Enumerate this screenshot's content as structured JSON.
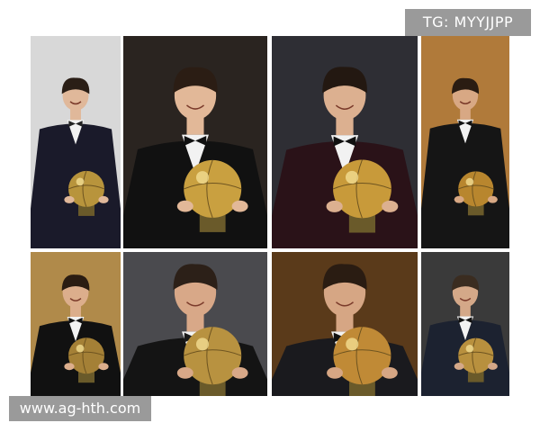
{
  "watermarks": {
    "top_right": "TG: MYYJJPP",
    "bottom_left": "www.ag-hth.com"
  },
  "tiles": [
    {
      "bg": "#d8d8d8",
      "suit": "#1a1a2a",
      "skin": "#e0b89a",
      "hair": "#2a1e16",
      "trophy": "#b8943c",
      "tie": "#222222"
    },
    {
      "bg": "#2a2420",
      "suit": "#111111",
      "skin": "#e2b898",
      "hair": "#2b1d14",
      "trophy": "#c9a040",
      "tie": "#111111"
    },
    {
      "bg": "#2e2e34",
      "suit": "#2a1218",
      "skin": "#dcb090",
      "hair": "#231811",
      "trophy": "#c89a3a",
      "tie": "#111111"
    },
    {
      "bg": "#b07a3a",
      "suit": "#151515",
      "skin": "#d8a884",
      "hair": "#2a1c12",
      "trophy": "#b8862e",
      "tie": "#111111"
    },
    {
      "bg": "#b08a4a",
      "suit": "#111111",
      "skin": "#dcae8c",
      "hair": "#2a1c12",
      "trophy": "#a48036",
      "tie": "#111111"
    },
    {
      "bg": "#4a4a4e",
      "suit": "#141414",
      "skin": "#d8a888",
      "hair": "#2c2018",
      "trophy": "#b89240",
      "tie": "#1a1a1a"
    },
    {
      "bg": "#5a3a1a",
      "suit": "#1a1a1e",
      "skin": "#d6a684",
      "hair": "#2a1c12",
      "trophy": "#c08a36",
      "tie": "#111111"
    },
    {
      "bg": "#3a3a3a",
      "suit": "#1c2230",
      "skin": "#d4a888",
      "hair": "#3a2c20",
      "trophy": "#b8903e",
      "tie": "#111111"
    }
  ]
}
